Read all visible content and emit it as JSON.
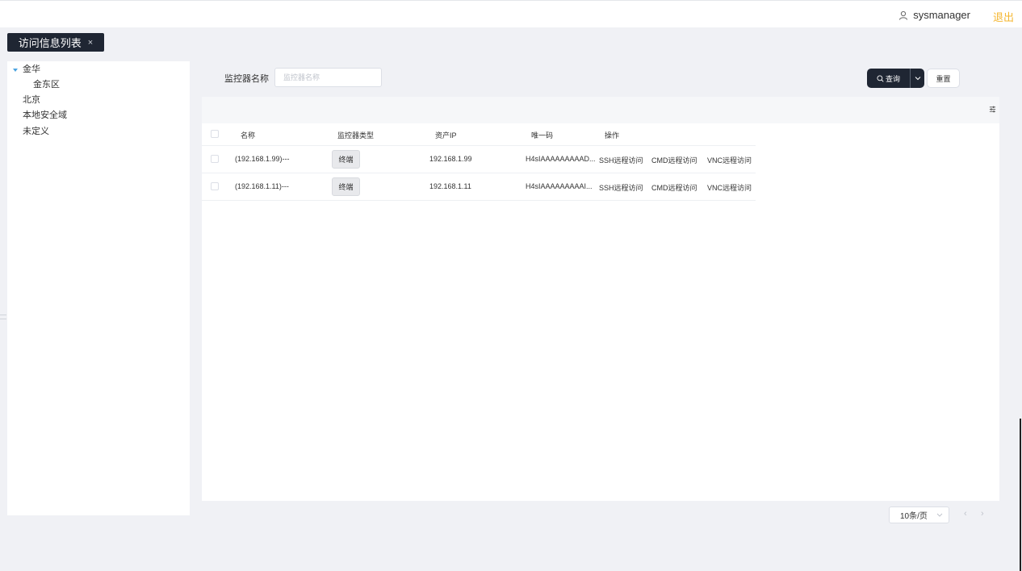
{
  "header": {
    "username": "sysmanager",
    "logout_label": "退出"
  },
  "tab": {
    "label": "访问信息列表",
    "close": "×"
  },
  "tree": {
    "items": [
      {
        "label": "金华",
        "expanded": true
      },
      {
        "label": "金东区"
      },
      {
        "label": "北京"
      },
      {
        "label": "本地安全域"
      },
      {
        "label": "未定义"
      }
    ]
  },
  "filter": {
    "label": "监控器名称",
    "placeholder": "监控器名称",
    "value": "",
    "query_label": "查询",
    "reset_label": "重置"
  },
  "table": {
    "columns": [
      "名称",
      "监控器类型",
      "资产IP",
      "唯一码",
      "操作"
    ],
    "rows": [
      {
        "name": "(192.168.1.99)---",
        "type": "终端",
        "ip": "192.168.1.99",
        "code": "H4sIAAAAAAAAAD...",
        "ops": [
          "SSH远程访问",
          "CMD远程访问",
          "VNC远程访问"
        ]
      },
      {
        "name": "(192.168.1.11)---",
        "type": "终端",
        "ip": "192.168.1.11",
        "code": "H4sIAAAAAAAAAI...",
        "ops": [
          "SSH远程访问",
          "CMD远程访问",
          "VNC远程访问"
        ]
      }
    ]
  },
  "pagination": {
    "page_size_label": "10条/页",
    "prev": "‹",
    "next": "›"
  },
  "colors": {
    "primary": "#1f2633",
    "accent": "#f5b731",
    "tree_caret": "#4aa3e0"
  }
}
